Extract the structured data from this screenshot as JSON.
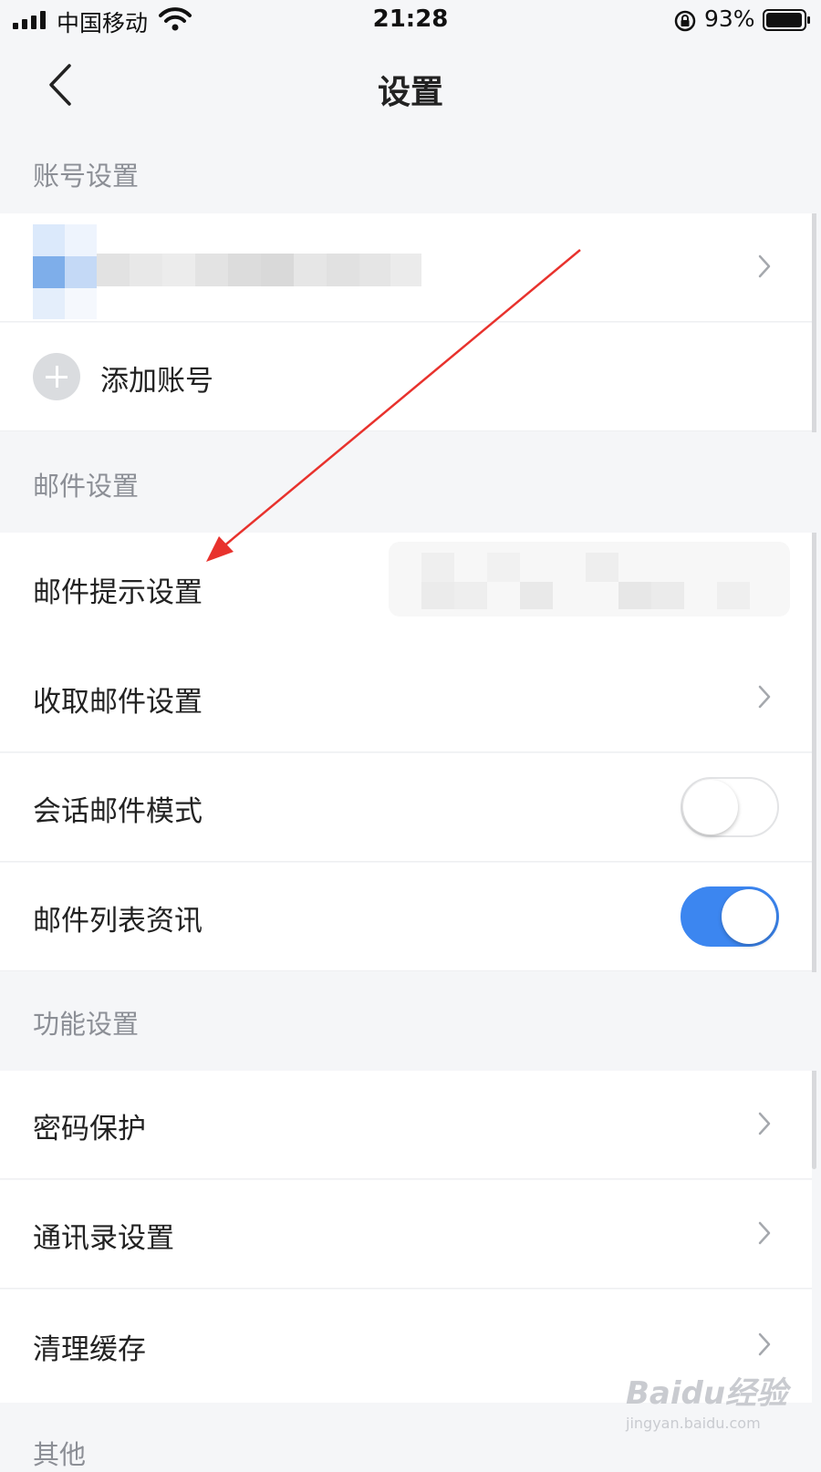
{
  "status_bar": {
    "carrier": "中国移动",
    "time": "21:28",
    "battery": "93%"
  },
  "nav": {
    "title": "设置"
  },
  "sections": {
    "account": {
      "header": "账号设置",
      "add_account": "添加账号"
    },
    "mail": {
      "header": "邮件设置",
      "notify": "邮件提示设置",
      "receive": "收取邮件设置",
      "conversation": "会话邮件模式",
      "conversation_enabled": false,
      "list_info": "邮件列表资讯",
      "list_info_enabled": true
    },
    "features": {
      "header": "功能设置",
      "password": "密码保护",
      "contacts": "通讯录设置",
      "clear_cache": "清理缓存"
    },
    "other": {
      "header": "其他"
    }
  },
  "watermark": {
    "logo": "Baidu经验",
    "url": "jingyan.baidu.com"
  },
  "colors": {
    "accent": "#3c86f0",
    "annotation_arrow": "#e8322d",
    "section_bg": "#f5f6f8"
  }
}
